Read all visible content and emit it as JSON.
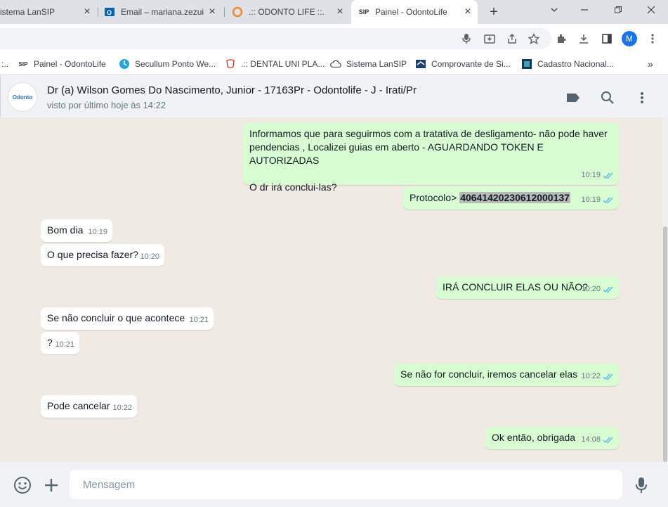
{
  "browser": {
    "tabs": [
      {
        "title": "istema LanSIP",
        "icon": "lansip-icon",
        "active": false
      },
      {
        "title": "Email – mariana.zezuin",
        "icon": "outlook-icon",
        "active": false
      },
      {
        "title": ".:: ODONTO LIFE ::.",
        "icon": "odontolife-icon",
        "active": false
      },
      {
        "title": "Painel - OdontoLife",
        "icon": "sip-icon",
        "active": true
      }
    ],
    "new_tab": "+",
    "profile_initial": "M",
    "bookmarks": [
      {
        "label": ":..",
        "icon": "more-icon"
      },
      {
        "label": "Painel - OdontoLife",
        "icon": "sip-icon"
      },
      {
        "label": "Secullum Ponto We...",
        "icon": "secullum-icon"
      },
      {
        "label": ".:: DENTAL UNI PLA...",
        "icon": "dental-icon"
      },
      {
        "label": "Sistema LanSIP",
        "icon": "cloud-icon"
      },
      {
        "label": "Comprovante de Si...",
        "icon": "receita-icon"
      },
      {
        "label": "Cadastro Nacional...",
        "icon": "cnpj-icon"
      }
    ],
    "bookmarks_more": "»"
  },
  "chat": {
    "contact_name": "Dr (a) Wilson Gomes Do Nascimento, Junior - 17163Pr - Odontolife - J - Irati/Pr",
    "status": "visto por último hoje às 14:22",
    "avatar_text": "Odonto",
    "messages": [
      {
        "dir": "out",
        "text": "Informamos que para seguirmos com a tratativa de desligamento- não pode haver\npendencias , Localizei guias em aberto - AGUARDANDO TOKEN E AUTORIZADAS\n\nO dr irá conclui-las?",
        "time": "10:19"
      },
      {
        "dir": "out",
        "prefix": "Protocolo> ",
        "highlight": "40641420230612000137",
        "time": "10:19"
      },
      {
        "dir": "in",
        "text": "Bom dia",
        "time": "10:19"
      },
      {
        "dir": "in",
        "text": "O que precisa fazer?",
        "time": "10:20"
      },
      {
        "dir": "out",
        "text": "IRÁ CONCLUIR ELAS OU NÃO?",
        "time": "10:20"
      },
      {
        "dir": "in",
        "text": "Se não concluir o que acontece",
        "time": "10:21"
      },
      {
        "dir": "in",
        "text": "?",
        "time": "10:21"
      },
      {
        "dir": "out",
        "text": "Se não for concluir, iremos cancelar elas",
        "time": "10:22"
      },
      {
        "dir": "in",
        "text": "Pode cancelar",
        "time": "10:22"
      },
      {
        "dir": "out",
        "text": "Ok então, obrigada",
        "time": "14:08"
      }
    ]
  },
  "composer": {
    "placeholder": "Mensagem"
  },
  "colors": {
    "outgoing_bubble": "#d9fdd3",
    "incoming_bubble": "#ffffff",
    "chat_background": "#efeae2",
    "read_ticks": "#53bdeb"
  }
}
